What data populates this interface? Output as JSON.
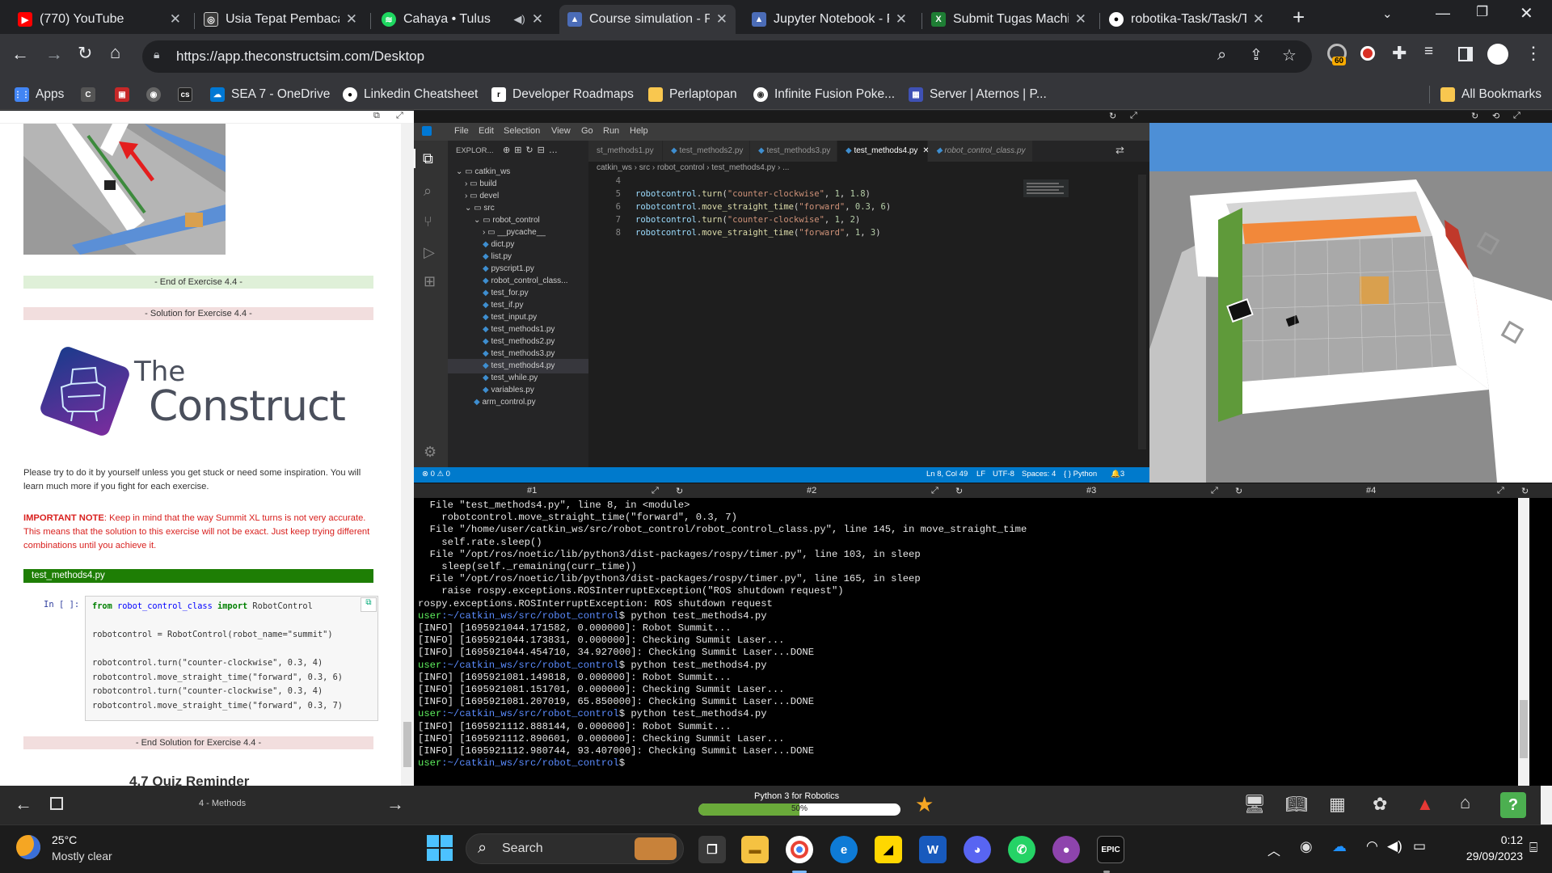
{
  "browser": {
    "tabs": [
      {
        "title": "(770) YouTube",
        "color": "#ff0000",
        "glyph": "▶"
      },
      {
        "title": "Usia Tepat Pembaca R",
        "color": "#2b2b2b",
        "glyph": "◎"
      },
      {
        "title": "Cahaya • Tulus",
        "color": "#1ed760",
        "glyph": "≋"
      },
      {
        "title": "Course simulation - P",
        "color": "#4b6cb7",
        "glyph": "▲"
      },
      {
        "title": "Jupyter Notebook - P",
        "color": "#4b6cb7",
        "glyph": "▲"
      },
      {
        "title": "Submit Tugas Machin",
        "color": "#1e7e34",
        "glyph": "X"
      },
      {
        "title": "robotika-Task/Task/Ta",
        "color": "#ffffff",
        "glyph": "●"
      }
    ],
    "new_tab": "+",
    "url": "https://app.theconstructsim.com/Desktop",
    "ext_badge": "60",
    "bookmarks": [
      {
        "label": "Apps",
        "color": "#4285f4",
        "glyph": "⋮⋮"
      },
      {
        "label": "",
        "color": "#555",
        "glyph": "C"
      },
      {
        "label": "",
        "color": "#c62828",
        "glyph": "▣"
      },
      {
        "label": "",
        "color": "#666",
        "glyph": "◉"
      },
      {
        "label": "",
        "color": "#222",
        "glyph": "cs"
      },
      {
        "label": "SEA 7 - OneDrive",
        "color": "#0078d4",
        "glyph": "☁"
      },
      {
        "label": "Linkedin Cheatsheet",
        "color": "#333",
        "glyph": "●"
      },
      {
        "label": "Developer Roadmaps",
        "color": "#000",
        "glyph": "r"
      },
      {
        "label": "Perlaptopan",
        "color": "#f9c74f",
        "glyph": "▮"
      },
      {
        "label": "Infinite Fusion Poke...",
        "color": "#555",
        "glyph": "◉"
      },
      {
        "label": "Server | Aternos | P...",
        "color": "#3f51b5",
        "glyph": "▦"
      }
    ],
    "all_bookmarks": "All Bookmarks"
  },
  "notebook": {
    "end_exercise": "- End of Exercise 4.4 -",
    "solution": "- Solution for Exercise 4.4 -",
    "logo_the": "The",
    "logo_construct": "Construct",
    "para": "Please try to do it by yourself unless you get stuck or need some inspiration. You will learn much more if you fight for each exercise.",
    "note_strong": "IMPORTANT NOTE",
    "note_rest": ": Keep in mind that the way Summit XL turns is not very accurate. This means that the solution to this exercise will not be exact. Just keep trying different combinations until you achieve it.",
    "file_label": "test_methods4.py",
    "prompt": "In [ ]:",
    "code_l1_kw1": "from",
    "code_l1_mod": "robot_control_class",
    "code_l1_kw2": "import",
    "code_l1_cls": "RobotControl",
    "code_l2": "robotcontrol = RobotControl(robot_name=\"summit\")",
    "code_l3": "robotcontrol.turn(\"counter-clockwise\", 0.3, 4)",
    "code_l4": "robotcontrol.move_straight_time(\"forward\", 0.3, 6)",
    "code_l5": "robotcontrol.turn(\"counter-clockwise\", 0.3, 4)",
    "code_l6": "robotcontrol.move_straight_time(\"forward\", 0.3, 7)",
    "end_solution": "- End Solution for Exercise 4.4 -",
    "quiz_heading": "4.7  Quiz Reminder"
  },
  "vscode": {
    "menu": [
      "File",
      "Edit",
      "Selection",
      "View",
      "Go",
      "Run",
      "Help"
    ],
    "explorer_title": "EXPLOR...",
    "tree": [
      {
        "label": "catkin_ws",
        "indent": 0,
        "kind": "dir-open"
      },
      {
        "label": "build",
        "indent": 1,
        "kind": "dir"
      },
      {
        "label": "devel",
        "indent": 1,
        "kind": "dir"
      },
      {
        "label": "src",
        "indent": 1,
        "kind": "dir-open"
      },
      {
        "label": "robot_control",
        "indent": 2,
        "kind": "dir-open"
      },
      {
        "label": "__pycache__",
        "indent": 3,
        "kind": "dir"
      },
      {
        "label": "dict.py",
        "indent": 3,
        "kind": "py"
      },
      {
        "label": "list.py",
        "indent": 3,
        "kind": "py"
      },
      {
        "label": "pyscript1.py",
        "indent": 3,
        "kind": "py"
      },
      {
        "label": "robot_control_class...",
        "indent": 3,
        "kind": "py"
      },
      {
        "label": "test_for.py",
        "indent": 3,
        "kind": "py"
      },
      {
        "label": "test_if.py",
        "indent": 3,
        "kind": "py"
      },
      {
        "label": "test_input.py",
        "indent": 3,
        "kind": "py"
      },
      {
        "label": "test_methods1.py",
        "indent": 3,
        "kind": "py"
      },
      {
        "label": "test_methods2.py",
        "indent": 3,
        "kind": "py"
      },
      {
        "label": "test_methods3.py",
        "indent": 3,
        "kind": "py"
      },
      {
        "label": "test_methods4.py",
        "indent": 3,
        "kind": "py",
        "selected": true
      },
      {
        "label": "test_while.py",
        "indent": 3,
        "kind": "py"
      },
      {
        "label": "variables.py",
        "indent": 3,
        "kind": "py"
      },
      {
        "label": "arm_control.py",
        "indent": 2,
        "kind": "py"
      }
    ],
    "tabs": [
      {
        "label": "st_methods1.py"
      },
      {
        "label": "test_methods2.py"
      },
      {
        "label": "test_methods3.py"
      },
      {
        "label": "test_methods4.py",
        "active": true
      },
      {
        "label": "robot_control_class.py",
        "italic": true
      }
    ],
    "breadcrumb": "catkin_ws  ›  src  ›  robot_control  ›  test_methods4.py  ›  ...",
    "lines": [
      {
        "n": "4",
        "obj": "",
        "fn": "",
        "a": "",
        "b": "",
        "c": ""
      },
      {
        "n": "5",
        "obj": "robotcontrol",
        "fn": "turn",
        "a": "\"counter-clockwise\"",
        "b": "1",
        "c": "1.8"
      },
      {
        "n": "6",
        "obj": "robotcontrol",
        "fn": "move_straight_time",
        "a": "\"forward\"",
        "b": "0.3",
        "c": "6"
      },
      {
        "n": "7",
        "obj": "robotcontrol",
        "fn": "turn",
        "a": "\"counter-clockwise\"",
        "b": "1",
        "c": "2"
      },
      {
        "n": "8",
        "obj": "robotcontrol",
        "fn": "move_straight_time",
        "a": "\"forward\"",
        "b": "1",
        "c": "3"
      }
    ],
    "status_left": "⊗ 0 ⚠ 0",
    "status_pos": "Ln 8, Col 49",
    "status_eol": "LF",
    "status_enc": "UTF-8",
    "status_spaces": "Spaces: 4",
    "status_lang": "{ } Python",
    "status_bell": "🔔3"
  },
  "terminal": {
    "tabs": [
      "#1",
      "#2",
      "#3",
      "#4"
    ],
    "lines": [
      {
        "t": "  File \"test_methods4.py\", line 8, in <module>"
      },
      {
        "t": "    robotcontrol.move_straight_time(\"forward\", 0.3, 7)"
      },
      {
        "t": "  File \"/home/user/catkin_ws/src/robot_control/robot_control_class.py\", line 145, in move_straight_time"
      },
      {
        "t": "    self.rate.sleep()"
      },
      {
        "t": "  File \"/opt/ros/noetic/lib/python3/dist-packages/rospy/timer.py\", line 103, in sleep"
      },
      {
        "t": "    sleep(self._remaining(curr_time))"
      },
      {
        "t": "  File \"/opt/ros/noetic/lib/python3/dist-packages/rospy/timer.py\", line 165, in sleep"
      },
      {
        "t": "    raise rospy.exceptions.ROSInterruptException(\"ROS shutdown request\")"
      },
      {
        "t": "rospy.exceptions.ROSInterruptException: ROS shutdown request"
      },
      {
        "u": "user",
        "p": ":~/catkin_ws/src/robot_control",
        "t": "$ python test_methods4.py"
      },
      {
        "t": "[INFO] [1695921044.171582, 0.000000]: Robot Summit..."
      },
      {
        "t": "[INFO] [1695921044.173831, 0.000000]: Checking Summit Laser..."
      },
      {
        "t": "[INFO] [1695921044.454710, 34.927000]: Checking Summit Laser...DONE"
      },
      {
        "u": "user",
        "p": ":~/catkin_ws/src/robot_control",
        "t": "$ python test_methods4.py"
      },
      {
        "t": "[INFO] [1695921081.149818, 0.000000]: Robot Summit..."
      },
      {
        "t": "[INFO] [1695921081.151701, 0.000000]: Checking Summit Laser..."
      },
      {
        "t": "[INFO] [1695921081.207019, 65.850000]: Checking Summit Laser...DONE"
      },
      {
        "u": "user",
        "p": ":~/catkin_ws/src/robot_control",
        "t": "$ python test_methods4.py"
      },
      {
        "t": "[INFO] [1695921112.888144, 0.000000]: Robot Summit..."
      },
      {
        "t": "[INFO] [1695921112.890601, 0.000000]: Checking Summit Laser..."
      },
      {
        "t": "[INFO] [1695921112.980744, 93.407000]: Checking Summit Laser...DONE"
      },
      {
        "u": "user",
        "p": ":~/catkin_ws/src/robot_control",
        "t": "$"
      }
    ]
  },
  "course": {
    "unit": "4 - Methods",
    "title": "Python 3 for Robotics",
    "progress_label": "50%",
    "progress": 0.5,
    "help": "?"
  },
  "taskbar": {
    "temp": "25°C",
    "weather": "Mostly clear",
    "search": "Search",
    "time": "0:12",
    "date": "29/09/2023"
  }
}
